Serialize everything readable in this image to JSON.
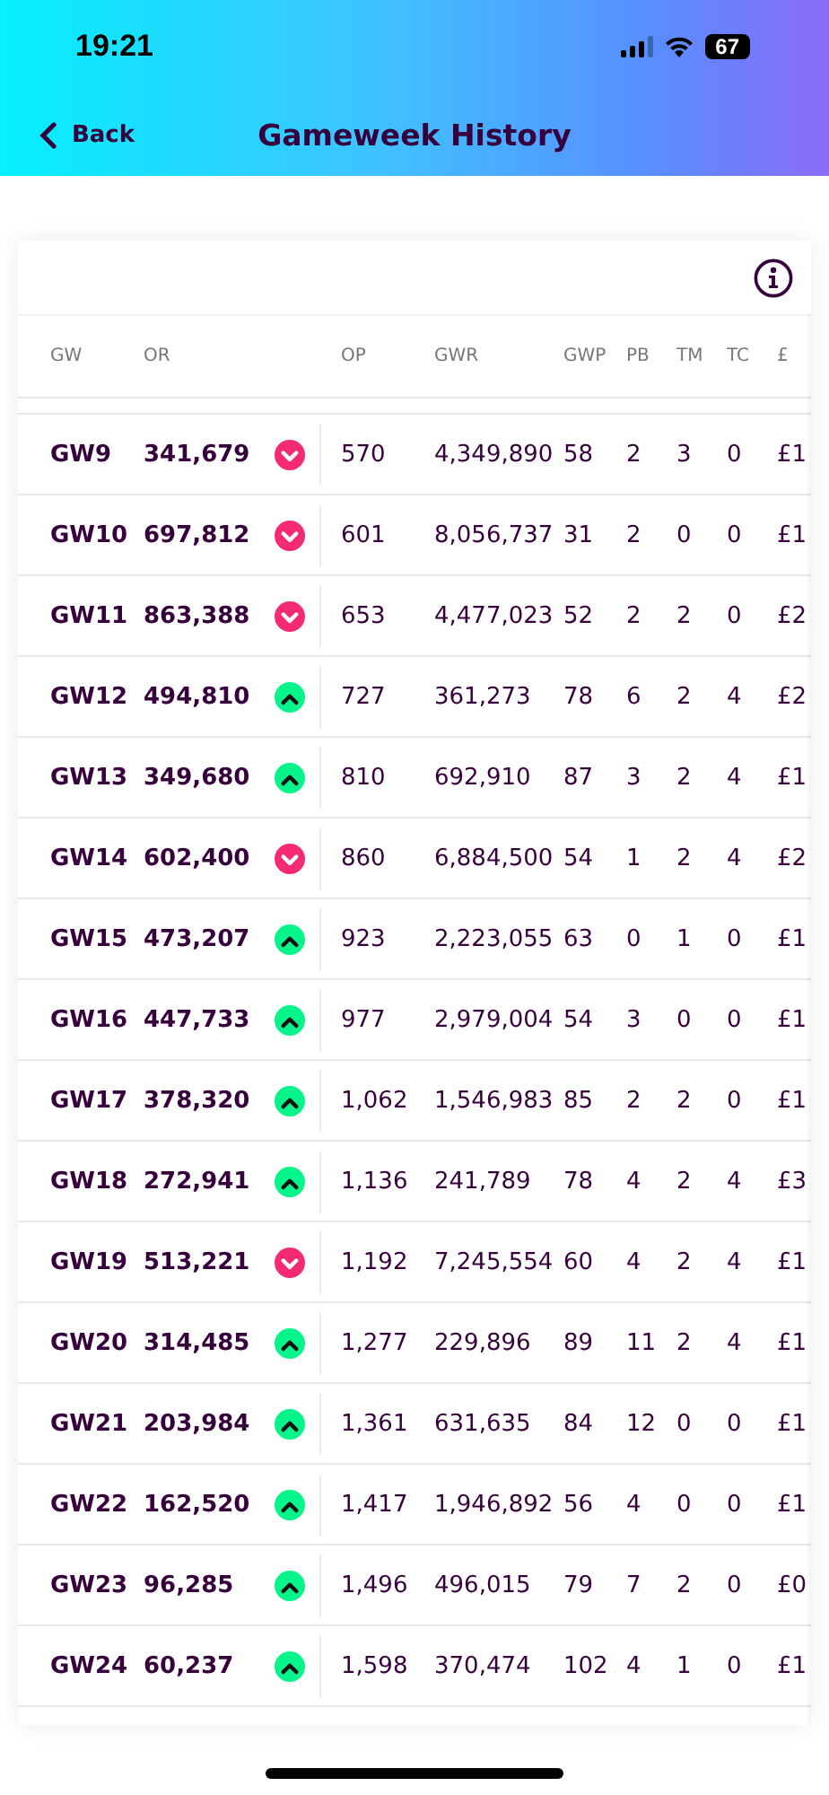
{
  "status_bar": {
    "time": "19:21",
    "battery": "67"
  },
  "nav": {
    "back": "Back",
    "title": "Gameweek History"
  },
  "table": {
    "columns": [
      "GW",
      "OR",
      "OP",
      "GWR",
      "GWP",
      "PB",
      "TM",
      "TC",
      "£"
    ],
    "rows": [
      {
        "gw": "GW9",
        "or": "341,679",
        "rank_up": false,
        "op": "570",
        "gwr": "4,349,890",
        "gwp": "58",
        "pb": "2",
        "tm": "3",
        "tc": "0",
        "money": "£1"
      },
      {
        "gw": "GW10",
        "or": "697,812",
        "rank_up": false,
        "op": "601",
        "gwr": "8,056,737",
        "gwp": "31",
        "pb": "2",
        "tm": "0",
        "tc": "0",
        "money": "£1"
      },
      {
        "gw": "GW11",
        "or": "863,388",
        "rank_up": false,
        "op": "653",
        "gwr": "4,477,023",
        "gwp": "52",
        "pb": "2",
        "tm": "2",
        "tc": "0",
        "money": "£2"
      },
      {
        "gw": "GW12",
        "or": "494,810",
        "rank_up": true,
        "op": "727",
        "gwr": "361,273",
        "gwp": "78",
        "pb": "6",
        "tm": "2",
        "tc": "4",
        "money": "£2"
      },
      {
        "gw": "GW13",
        "or": "349,680",
        "rank_up": true,
        "op": "810",
        "gwr": "692,910",
        "gwp": "87",
        "pb": "3",
        "tm": "2",
        "tc": "4",
        "money": "£1"
      },
      {
        "gw": "GW14",
        "or": "602,400",
        "rank_up": false,
        "op": "860",
        "gwr": "6,884,500",
        "gwp": "54",
        "pb": "1",
        "tm": "2",
        "tc": "4",
        "money": "£2"
      },
      {
        "gw": "GW15",
        "or": "473,207",
        "rank_up": true,
        "op": "923",
        "gwr": "2,223,055",
        "gwp": "63",
        "pb": "0",
        "tm": "1",
        "tc": "0",
        "money": "£1"
      },
      {
        "gw": "GW16",
        "or": "447,733",
        "rank_up": true,
        "op": "977",
        "gwr": "2,979,004",
        "gwp": "54",
        "pb": "3",
        "tm": "0",
        "tc": "0",
        "money": "£1"
      },
      {
        "gw": "GW17",
        "or": "378,320",
        "rank_up": true,
        "op": "1,062",
        "gwr": "1,546,983",
        "gwp": "85",
        "pb": "2",
        "tm": "2",
        "tc": "0",
        "money": "£1"
      },
      {
        "gw": "GW18",
        "or": "272,941",
        "rank_up": true,
        "op": "1,136",
        "gwr": "241,789",
        "gwp": "78",
        "pb": "4",
        "tm": "2",
        "tc": "4",
        "money": "£3"
      },
      {
        "gw": "GW19",
        "or": "513,221",
        "rank_up": false,
        "op": "1,192",
        "gwr": "7,245,554",
        "gwp": "60",
        "pb": "4",
        "tm": "2",
        "tc": "4",
        "money": "£1"
      },
      {
        "gw": "GW20",
        "or": "314,485",
        "rank_up": true,
        "op": "1,277",
        "gwr": "229,896",
        "gwp": "89",
        "pb": "11",
        "tm": "2",
        "tc": "4",
        "money": "£1"
      },
      {
        "gw": "GW21",
        "or": "203,984",
        "rank_up": true,
        "op": "1,361",
        "gwr": "631,635",
        "gwp": "84",
        "pb": "12",
        "tm": "0",
        "tc": "0",
        "money": "£1"
      },
      {
        "gw": "GW22",
        "or": "162,520",
        "rank_up": true,
        "op": "1,417",
        "gwr": "1,946,892",
        "gwp": "56",
        "pb": "4",
        "tm": "0",
        "tc": "0",
        "money": "£1"
      },
      {
        "gw": "GW23",
        "or": "96,285",
        "rank_up": true,
        "op": "1,496",
        "gwr": "496,015",
        "gwp": "79",
        "pb": "7",
        "tm": "2",
        "tc": "0",
        "money": "£0"
      },
      {
        "gw": "GW24",
        "or": "60,237",
        "rank_up": true,
        "op": "1,598",
        "gwr": "370,474",
        "gwp": "102",
        "pb": "4",
        "tm": "1",
        "tc": "0",
        "money": "£1"
      }
    ]
  }
}
